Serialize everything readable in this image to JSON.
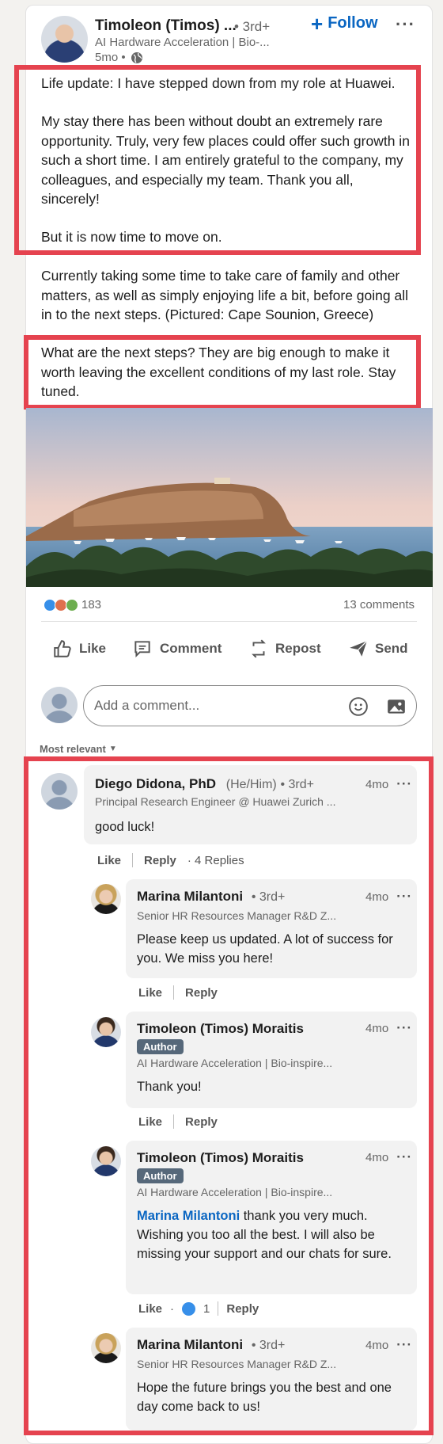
{
  "post": {
    "author": {
      "name": "Timoleon (Timos) ...",
      "degree": "• 3rd+",
      "headline": "AI Hardware Acceleration | Bio-...",
      "time": "5mo •",
      "visibility_icon": "globe-icon"
    },
    "follow_label": "Follow",
    "more_icon": "more-options-icon",
    "paragraphs": [
      "Life update: I have stepped down from my role at Huawei.",
      "My stay there has been without doubt an extremely rare opportunity. Truly, very few places could offer such growth in such a short time. I am entirely grateful to the company, my colleagues, and especially my team. Thank you all, sincerely!",
      "But it is now time to move on.",
      "Currently taking some time to take care of family and other matters, as well as simply enjoying life a bit, before going all in to the next steps. (Pictured: Cape Sounion, Greece)",
      "What are the next steps? They are big enough to make it worth leaving the excellent conditions of my last role. Stay tuned."
    ],
    "reactions_count": "183",
    "comments_count": "13 comments",
    "actions": {
      "like": "Like",
      "comment": "Comment",
      "repost": "Repost",
      "send": "Send"
    },
    "comment_placeholder": "Add a comment...",
    "sort_label": "Most relevant"
  },
  "comments": [
    {
      "name": "Diego Didona, PhD",
      "pronouns": "(He/Him)",
      "degree": "• 3rd+",
      "headline": "Principal Research Engineer @ Huawei Zurich ...",
      "time": "4mo",
      "text": "good luck!",
      "like": "Like",
      "reply": "Reply",
      "replies": "· 4 Replies"
    },
    {
      "name": "Marina Milantoni",
      "degree": "• 3rd+",
      "headline": "Senior HR Resources Manager R&D Z...",
      "time": "4mo",
      "text": "Please keep us updated. A lot of success for you. We miss you here!",
      "like": "Like",
      "reply": "Reply"
    },
    {
      "name": "Timoleon (Timos) Moraitis",
      "badge": "Author",
      "headline": "AI Hardware Acceleration | Bio-inspire...",
      "time": "4mo",
      "text": "Thank you!",
      "like": "Like",
      "reply": "Reply"
    },
    {
      "name": "Timoleon (Timos) Moraitis",
      "badge": "Author",
      "headline": "AI Hardware Acceleration | Bio-inspire...",
      "time": "4mo",
      "mention": "Marina Milantoni",
      "text": "thank you very much. Wishing you too all the best. I will also be missing your support and our chats for sure.",
      "like": "Like",
      "like_count": "1",
      "reply": "Reply"
    },
    {
      "name": "Marina Milantoni",
      "degree": "• 3rd+",
      "headline": "Senior HR Resources Manager R&D Z...",
      "time": "4mo",
      "text": "Hope the future brings you the best and one day come back to us!"
    }
  ],
  "colors": {
    "accent": "#0a66c2",
    "highlight": "#e5434f",
    "badge": "#56687a"
  }
}
